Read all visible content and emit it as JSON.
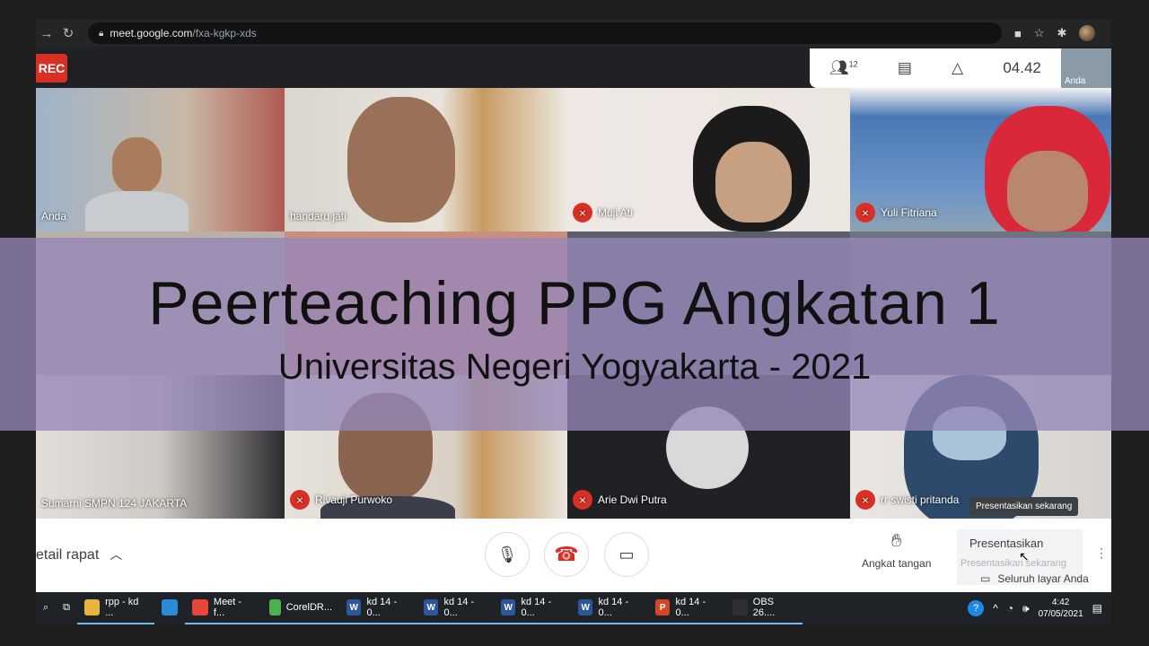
{
  "browser": {
    "url_host": "meet.google.com",
    "url_path": "/fxa-kgkp-xds"
  },
  "meet": {
    "rec_label": "REC",
    "participant_count": "12",
    "time": "04.42",
    "self_label": "Anda"
  },
  "participants": [
    {
      "name": "Anda",
      "muted": false
    },
    {
      "name": "handaru jati",
      "muted": false
    },
    {
      "name": "Muji Ati",
      "muted": true
    },
    {
      "name": "Yuli Fitriana",
      "muted": true
    },
    {
      "name": "Sumarni SMPN 124 JAKARTA",
      "muted": false
    },
    {
      "name": "Rivauji Purwoko",
      "muted": true
    },
    {
      "name": "Arie Dwi Putra",
      "muted": true
    },
    {
      "name": "rr swisti pritanda",
      "muted": true
    }
  ],
  "overlay": {
    "title": "Peerteaching PPG Angkatan 1",
    "subtitle": "Universitas Negeri Yogyakarta - 2021"
  },
  "bottom_bar": {
    "details_label": "etail rapat",
    "raise_hand": "Angkat tangan",
    "present": "Presentasikan",
    "present_ghost": "Presentasikan sekarang",
    "tooltip": "Presentasikan sekarang",
    "menu_item": "Seluruh layar Anda"
  },
  "taskbar": {
    "apps": [
      {
        "label": "rpp - kd ...",
        "icon": "folder-icon",
        "color": "#e7b53c"
      },
      {
        "label": "",
        "icon": "edge-icon",
        "color": "#2a8ad8"
      },
      {
        "label": "Meet - f...",
        "icon": "chrome-icon",
        "color": "#e8453c"
      },
      {
        "label": "CorelDR...",
        "icon": "coreldraw-icon",
        "color": "#4caf50"
      },
      {
        "label": "kd 14 - 0...",
        "icon": "word-icon",
        "color": "#2b579a"
      },
      {
        "label": "kd 14 - 0...",
        "icon": "word-icon",
        "color": "#2b579a"
      },
      {
        "label": "kd 14 - 0...",
        "icon": "word-icon",
        "color": "#2b579a"
      },
      {
        "label": "kd 14 - 0...",
        "icon": "word-icon",
        "color": "#2b579a"
      },
      {
        "label": "kd 14 - 0...",
        "icon": "powerpoint-icon",
        "color": "#d24726"
      },
      {
        "label": "OBS 26....",
        "icon": "obs-icon",
        "color": "#302e31"
      }
    ],
    "time": "4:42",
    "date": "07/05/2021"
  }
}
